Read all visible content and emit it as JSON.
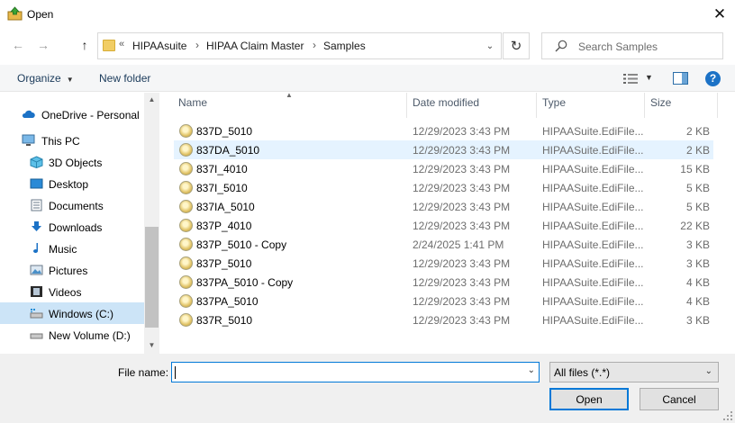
{
  "window": {
    "title": "Open",
    "close_glyph": "✕"
  },
  "nav_buttons": {
    "back": "←",
    "forward": "→",
    "up": "↑"
  },
  "address": {
    "overflow_glyph": "«",
    "crumbs": [
      "HIPAAsuite",
      "HIPAA Claim Master",
      "Samples"
    ],
    "separator": "›",
    "dropdown_glyph": "⌄",
    "refresh_glyph": "↻"
  },
  "search": {
    "placeholder": "Search Samples"
  },
  "toolbar": {
    "organize_label": "Organize",
    "new_folder_label": "New folder",
    "help_label": "?"
  },
  "navigation": {
    "items": [
      {
        "label": "OneDrive - Personal",
        "icon": "cloud-icon"
      },
      {
        "label": "This PC",
        "icon": "computer-icon"
      },
      {
        "label": "3D Objects",
        "icon": "cube-icon"
      },
      {
        "label": "Desktop",
        "icon": "desktop-icon"
      },
      {
        "label": "Documents",
        "icon": "document-icon"
      },
      {
        "label": "Downloads",
        "icon": "download-icon"
      },
      {
        "label": "Music",
        "icon": "music-icon"
      },
      {
        "label": "Pictures",
        "icon": "pictures-icon"
      },
      {
        "label": "Videos",
        "icon": "video-icon"
      },
      {
        "label": "Windows (C:)",
        "icon": "drive-icon",
        "selected": true
      },
      {
        "label": "New Volume (D:)",
        "icon": "drive-icon"
      }
    ]
  },
  "columns": {
    "name": "Name",
    "date": "Date modified",
    "type": "Type",
    "size": "Size"
  },
  "files": [
    {
      "name": "837D_5010",
      "date": "12/29/2023 3:43 PM",
      "type": "HIPAASuite.EdiFile...",
      "size": "2 KB"
    },
    {
      "name": "837DA_5010",
      "date": "12/29/2023 3:43 PM",
      "type": "HIPAASuite.EdiFile...",
      "size": "2 KB",
      "selected": true
    },
    {
      "name": "837I_4010",
      "date": "12/29/2023 3:43 PM",
      "type": "HIPAASuite.EdiFile...",
      "size": "15 KB"
    },
    {
      "name": "837I_5010",
      "date": "12/29/2023 3:43 PM",
      "type": "HIPAASuite.EdiFile...",
      "size": "5 KB"
    },
    {
      "name": "837IA_5010",
      "date": "12/29/2023 3:43 PM",
      "type": "HIPAASuite.EdiFile...",
      "size": "5 KB"
    },
    {
      "name": "837P_4010",
      "date": "12/29/2023 3:43 PM",
      "type": "HIPAASuite.EdiFile...",
      "size": "22 KB"
    },
    {
      "name": "837P_5010 - Copy",
      "date": "2/24/2025 1:41 PM",
      "type": "HIPAASuite.EdiFile...",
      "size": "3 KB"
    },
    {
      "name": "837P_5010",
      "date": "12/29/2023 3:43 PM",
      "type": "HIPAASuite.EdiFile...",
      "size": "3 KB"
    },
    {
      "name": "837PA_5010 - Copy",
      "date": "12/29/2023 3:43 PM",
      "type": "HIPAASuite.EdiFile...",
      "size": "4 KB"
    },
    {
      "name": "837PA_5010",
      "date": "12/29/2023 3:43 PM",
      "type": "HIPAASuite.EdiFile...",
      "size": "4 KB"
    },
    {
      "name": "837R_5010",
      "date": "12/29/2023 3:43 PM",
      "type": "HIPAASuite.EdiFile...",
      "size": "3 KB"
    }
  ],
  "footer": {
    "file_name_label": "File name:",
    "file_name_value": "",
    "filter_value": "All files (*.*)",
    "open_label": "Open",
    "cancel_label": "Cancel"
  },
  "colors": {
    "accent": "#0078d7",
    "selection": "#cce4f7",
    "hover_row": "#e5f3ff",
    "chrome": "#f0f0f0"
  }
}
